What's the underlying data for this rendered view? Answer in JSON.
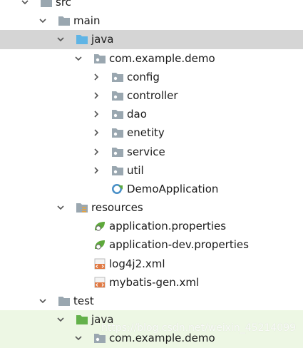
{
  "tree": {
    "src": "src",
    "main": "main",
    "java": "java",
    "package": "com.example.demo",
    "config": "config",
    "controller": "controller",
    "dao": "dao",
    "enetity": "enetity",
    "service": "service",
    "util": "util",
    "demo_application": "DemoApplication",
    "resources": "resources",
    "application_properties": "application.properties",
    "application_dev_properties": "application-dev.properties",
    "log4j2": "log4j2.xml",
    "mybatis_gen": "mybatis-gen.xml",
    "test": "test",
    "test_java": "java",
    "test_package": "com.example.demo"
  },
  "watermark": "https://blog.csdn.net/weixin_45214099",
  "colors": {
    "folder": "#9aa7b0",
    "source_folder": "#5fb4e5",
    "test_folder": "#63b14a",
    "spring_leaf": "#5ea93b",
    "xml": "#e07a45",
    "selection": "#d5d5d5",
    "test_highlight": "#edf7e4"
  }
}
